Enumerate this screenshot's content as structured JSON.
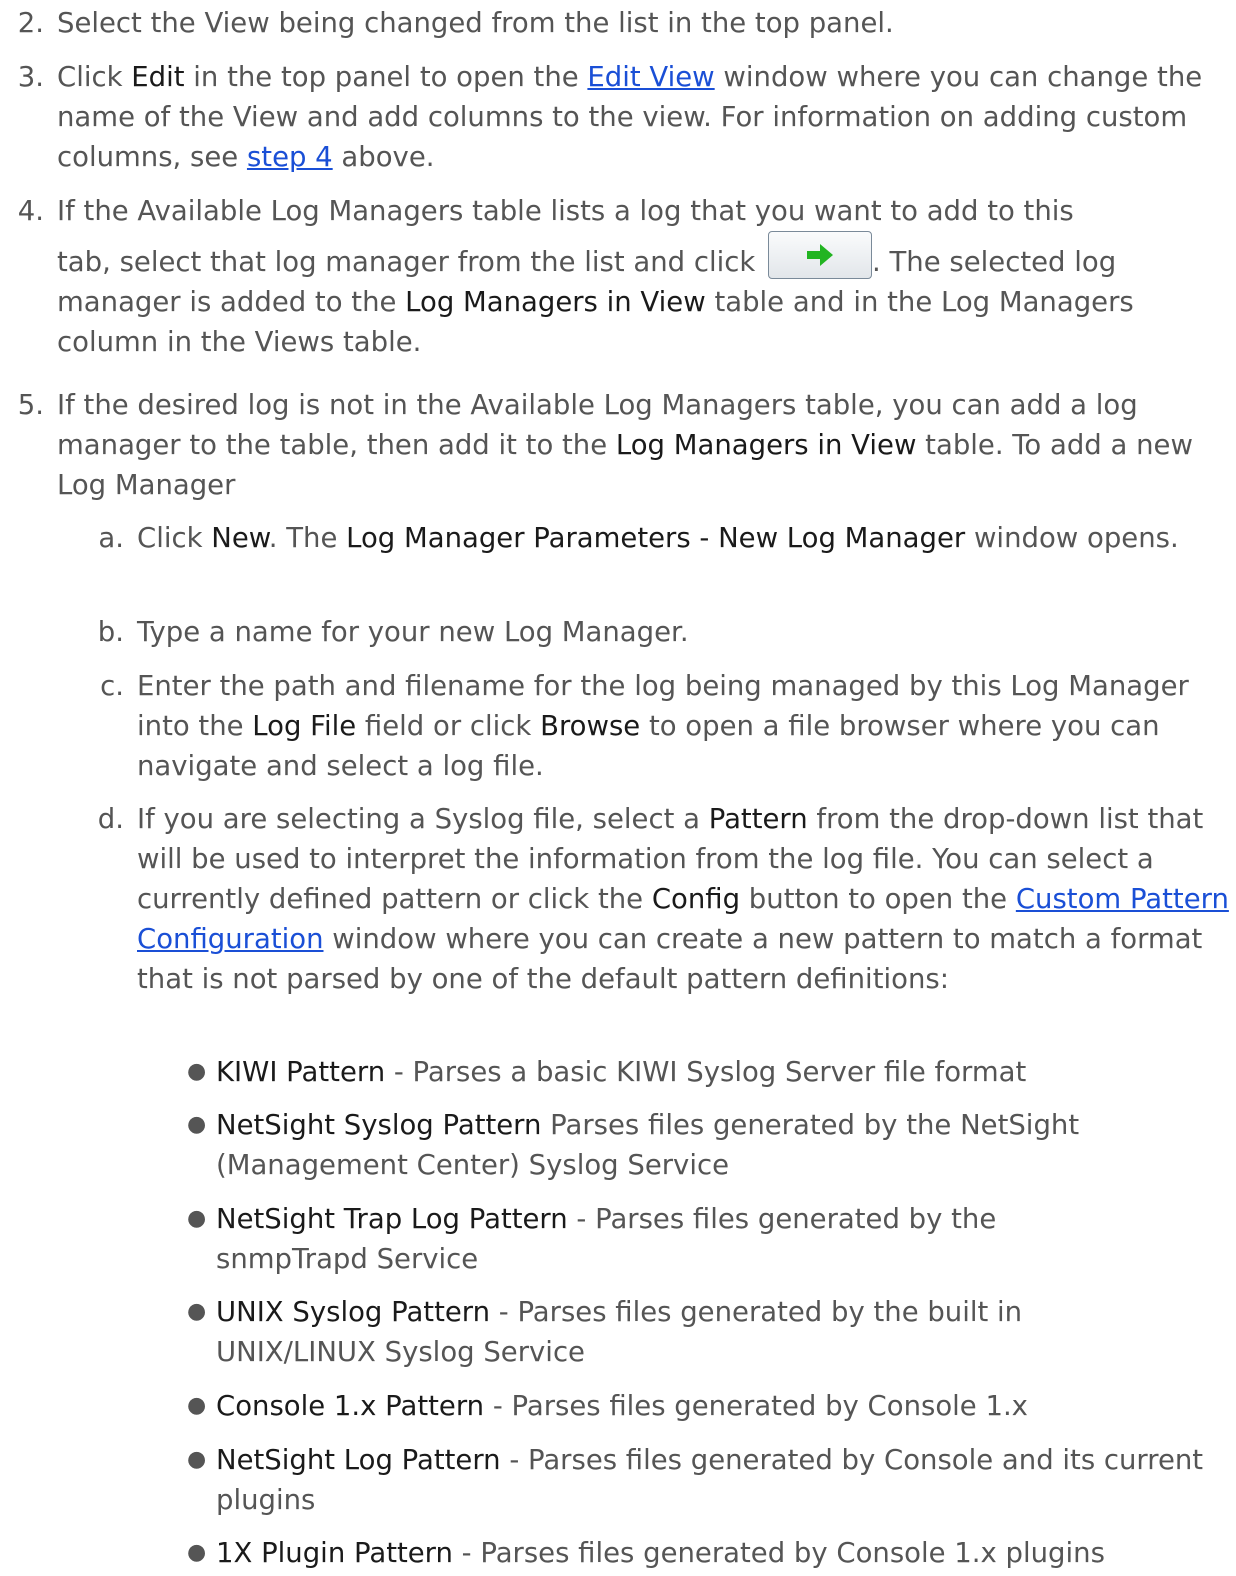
{
  "steps": [
    {
      "num": "2.",
      "parts": [
        {
          "t": "Select the View being changed from the list in the top panel."
        }
      ]
    },
    {
      "num": "3.",
      "parts": [
        {
          "t": "Click "
        },
        {
          "b": "Edit"
        },
        {
          "t": " in the top panel to open the "
        },
        {
          "a": "Edit View"
        },
        {
          "t": " window where you can change the name of the View and add columns to the view. For information on adding custom columns, see "
        },
        {
          "a": "step 4"
        },
        {
          "t": " above."
        }
      ]
    },
    {
      "num": "4.",
      "parts": [
        {
          "t": "If the Available Log Managers table lists a log that you want to add to this"
        },
        {
          "br": true
        },
        {
          "t": "tab, select that log manager from the list and click "
        },
        {
          "btn": "arrow-right"
        },
        {
          "t": ". The selected log manager is added to the "
        },
        {
          "b": "Log Managers in View"
        },
        {
          "t": " table and in the Log Managers column in the Views table."
        }
      ]
    },
    {
      "num": "5.",
      "parts": [
        {
          "t": "If the desired log is not in the Available Log Managers table, you can add a log manager to the table, then add it to the "
        },
        {
          "b": "Log Managers in View"
        },
        {
          "t": " table. To add a new Log Manager"
        }
      ]
    }
  ],
  "substeps": [
    {
      "num": "a.",
      "parts": [
        {
          "t": "Click "
        },
        {
          "b": "New"
        },
        {
          "t": ". The "
        },
        {
          "b": "Log Manager Parameters - New Log Manager"
        },
        {
          "t": " window opens."
        }
      ]
    },
    {
      "num": "b.",
      "parts": [
        {
          "t": "Type a name for your new Log Manager."
        }
      ]
    },
    {
      "num": "c.",
      "parts": [
        {
          "t": "Enter the path and filename for the log being managed by this Log Manager into the "
        },
        {
          "b": "Log File"
        },
        {
          "t": " field or click "
        },
        {
          "b": "Browse"
        },
        {
          "t": " to open a file browser where you can navigate and select a log file."
        }
      ]
    },
    {
      "num": "d.",
      "parts": [
        {
          "t": "If you are selecting a Syslog file, select a "
        },
        {
          "b": "Pattern"
        },
        {
          "t": " from the drop-down list that will be used to interpret the information from the log file. You can select a currently defined pattern or click the "
        },
        {
          "b": "Config"
        },
        {
          "t": " button to open the "
        },
        {
          "a": "Custom Pattern Configuration"
        },
        {
          "t": " window where you can create a new pattern to match a format that is not parsed by one of the default pattern definitions:"
        }
      ]
    }
  ],
  "patterns": [
    {
      "name": "KIWI Pattern",
      "desc": " - Parses a basic KIWI Syslog Server file format"
    },
    {
      "name": "NetSight Syslog Pattern",
      "desc": " Parses files generated by the NetSight (Management Center) Syslog Service"
    },
    {
      "name": "NetSight Trap Log Pattern",
      "desc": " - Parses files generated by the snmpTrapd Service"
    },
    {
      "name": "UNIX Syslog Pattern",
      "desc": " - Parses files generated by the built in UNIX/LINUX Syslog Service"
    },
    {
      "name": "Console 1.x Pattern",
      "desc": " - Parses files generated by Console 1.x"
    },
    {
      "name": "NetSight Log Pattern",
      "desc": " - Parses files generated by Console and its current plugins"
    },
    {
      "name": "1X Plugin Pattern",
      "desc": " - Parses files generated by Console 1.x plugins"
    }
  ],
  "colors": {
    "text": "#555555",
    "emphasis": "#1a1a1a",
    "link": "#1a4fd6",
    "arrow": "#22b422"
  },
  "icons": {
    "add_button_icon": "arrow-right-icon"
  }
}
